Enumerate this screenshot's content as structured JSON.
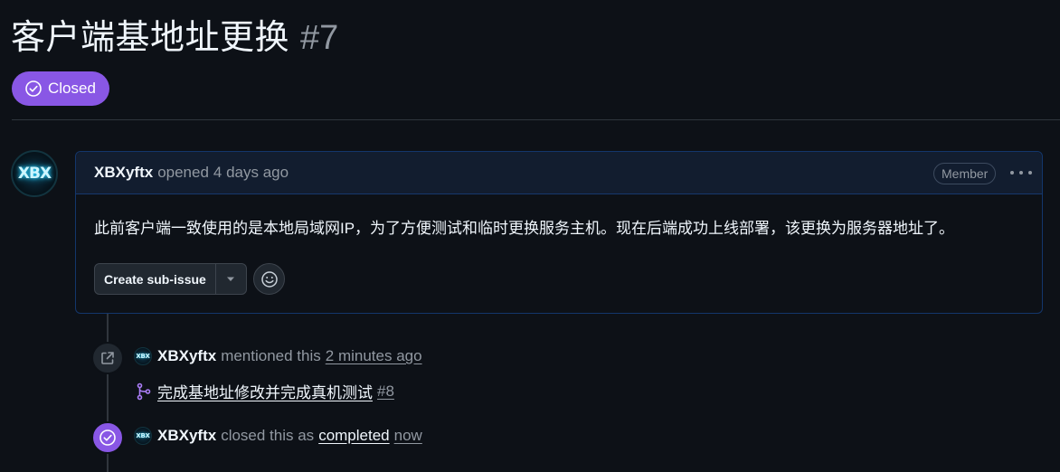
{
  "issue": {
    "title": "客户端基地址更换",
    "number": "#7",
    "state_label": "Closed",
    "state_color": "#8957e5"
  },
  "avatar": {
    "icon": "xbx-logo-avatar",
    "logo_text": "XBX"
  },
  "comment": {
    "author": "XBXyftx",
    "action": "opened",
    "time": "4 days ago",
    "role_badge": "Member",
    "body": "此前客户端一致使用的是本地局域网IP，为了方便测试和临时更换服务主机。现在后端成功上线部署，该更换为服务器地址了。",
    "create_subissue_label": "Create sub-issue"
  },
  "timeline": [
    {
      "type": "mention",
      "icon": "cross-reference-icon",
      "author": "XBXyftx",
      "action": "mentioned this",
      "time": "2 minutes ago",
      "ref_title": "完成基地址修改并完成真机测试",
      "ref_number": "#8"
    },
    {
      "type": "closed",
      "icon": "check-circle-icon",
      "author": "XBXyftx",
      "action": "closed this as",
      "reason": "completed",
      "time": "now"
    }
  ],
  "colors": {
    "background": "#0d1117",
    "accent_purple": "#8957e5",
    "muted_text": "#9198a1",
    "comment_header_bg": "#121d2f"
  }
}
